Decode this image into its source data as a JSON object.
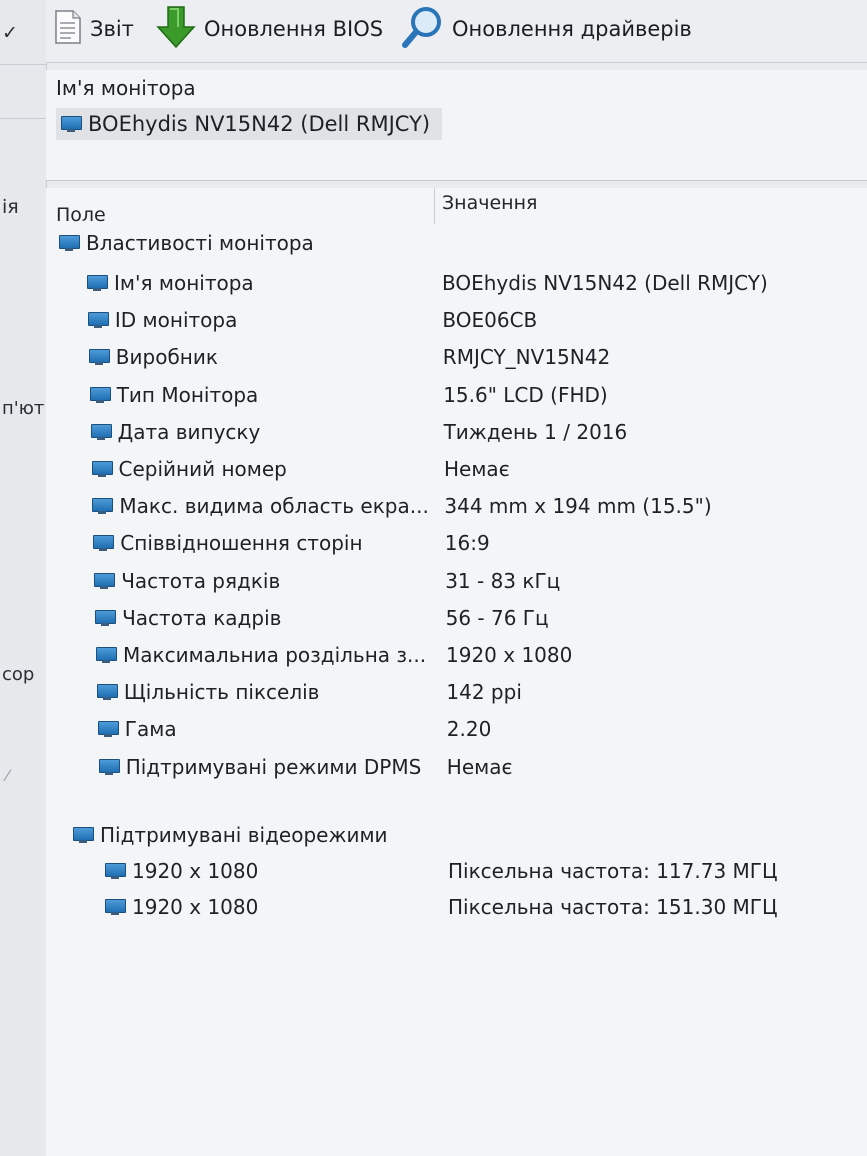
{
  "toolbar": {
    "report_label": "Звіт",
    "bios_label": "Оновлення BIOS",
    "drivers_label": "Оновлення драйверів"
  },
  "sidebar_fragments": [
    "ія",
    "п'ют",
    "сор"
  ],
  "header": {
    "caption": "Ім'я монітора",
    "monitor_name": "BOEhydis NV15N42 (Dell RMJCY)"
  },
  "table": {
    "col_field": "Поле",
    "col_value": "Значення",
    "group1": "Властивості монітора",
    "rows": [
      {
        "field": "Ім'я монітора",
        "value": "BOEhydis NV15N42 (Dell RMJCY)"
      },
      {
        "field": "ID монітора",
        "value": "BOE06CB"
      },
      {
        "field": "Виробник",
        "value": "RMJCY_NV15N42"
      },
      {
        "field": "Тип Монітора",
        "value": "15.6\" LCD (FHD)"
      },
      {
        "field": "Дата випуску",
        "value": "Тиждень 1 / 2016"
      },
      {
        "field": "Серійний номер",
        "value": "Немає"
      },
      {
        "field": "Макс. видима область екра...",
        "value": "344 mm x 194 mm (15.5\")"
      },
      {
        "field": "Співвідношення сторін",
        "value": "16:9"
      },
      {
        "field": "Частота рядків",
        "value": "31 - 83 кГц"
      },
      {
        "field": "Частота кадрів",
        "value": "56 - 76 Гц"
      },
      {
        "field": "Максимальниа роздільна з...",
        "value": "1920 x 1080"
      },
      {
        "field": "Щільність пікселів",
        "value": "142 ppi"
      },
      {
        "field": "Гама",
        "value": "2.20"
      },
      {
        "field": "Підтримувані режими DPMS",
        "value": "Немає"
      }
    ],
    "group2": "Підтримувані відеорежими",
    "modes": [
      {
        "field": "1920 x 1080",
        "value": "Піксельна частота: 117.73 МГЦ"
      },
      {
        "field": "1920 x 1080",
        "value": "Піксельна частота: 151.30 МГЦ"
      }
    ]
  },
  "icons": {
    "report": "document-icon",
    "bios": "download-arrow-icon",
    "drivers": "magnifier-icon",
    "row": "monitor-icon"
  },
  "colors": {
    "monitor_icon": "#2f7fc1",
    "bios_arrow": "#3a9a2a",
    "magnifier": "#2a74b8"
  }
}
